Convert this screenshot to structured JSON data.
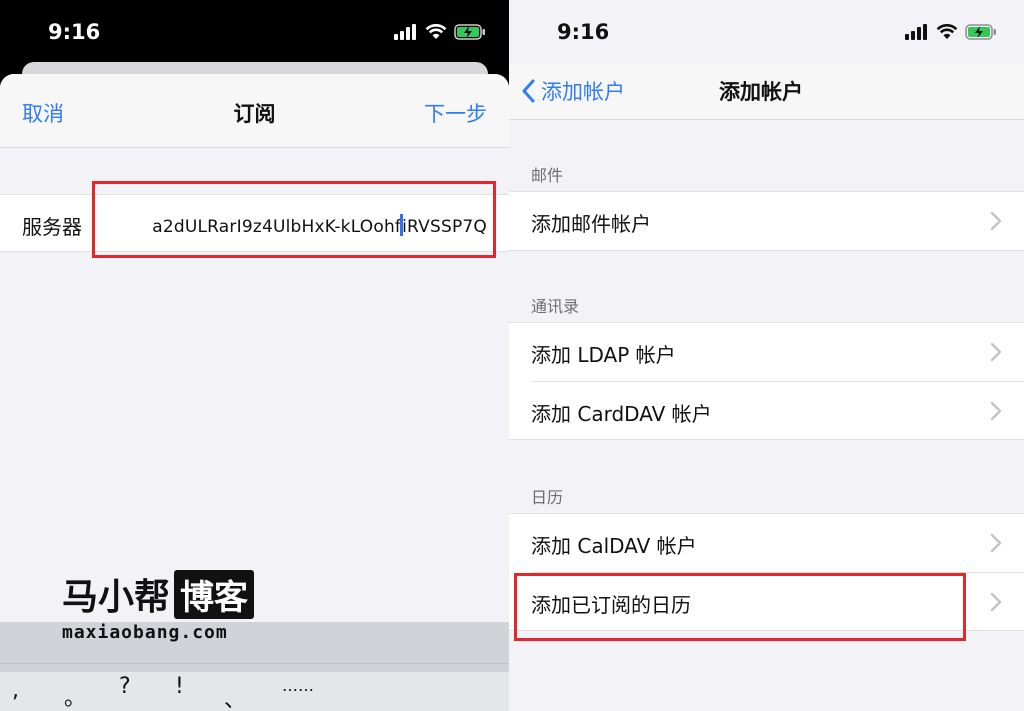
{
  "left": {
    "status": {
      "time": "9:16"
    },
    "sheet": {
      "cancel": "取消",
      "title": "订阅",
      "next": "下一步",
      "server_label": "服务器",
      "server_value_a": "a2dULRarI9z4UlbHxK-kLOohf",
      "server_value_b": "iRVSSP7Q"
    },
    "watermark": {
      "name": "马小帮",
      "boxed": "博客",
      "site": "maxiaobang.com"
    },
    "keyboard": {
      "keys": [
        ",",
        "。",
        "?",
        "!",
        "、",
        "……"
      ]
    }
  },
  "right": {
    "status": {
      "time": "9:16"
    },
    "nav": {
      "back_label": "添加帐户",
      "title": "添加帐户"
    },
    "sections": [
      {
        "header": "邮件",
        "items": [
          "添加邮件帐户"
        ]
      },
      {
        "header": "通讯录",
        "items": [
          "添加 LDAP 帐户",
          "添加 CardDAV 帐户"
        ]
      },
      {
        "header": "日历",
        "items": [
          "添加 CalDAV 帐户",
          "添加已订阅的日历"
        ]
      }
    ]
  },
  "colors": {
    "accent": "#2f7cf6",
    "highlight": "#e0282d",
    "grouped_background": "#f2f2f7"
  }
}
